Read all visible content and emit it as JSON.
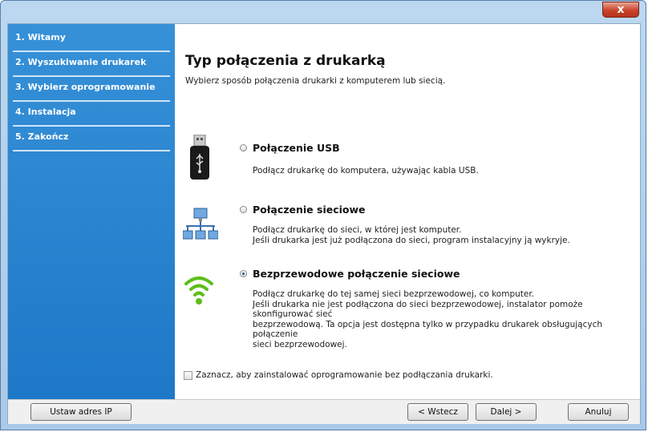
{
  "window": {
    "close_symbol": "x"
  },
  "sidebar": {
    "items": [
      {
        "label": "1. Witamy"
      },
      {
        "label": "2. Wyszukiwanie drukarek"
      },
      {
        "label": "3. Wybierz oprogramowanie"
      },
      {
        "label": "4. Instalacja"
      },
      {
        "label": "5. Zakończ"
      }
    ]
  },
  "main": {
    "title": "Typ połączenia z drukarką",
    "subtitle": "Wybierz sposób połączenia drukarki z komputerem lub siecią.",
    "options": [
      {
        "title": "Połączenie USB",
        "icon": "usb-drive-icon",
        "selected": false,
        "description": [
          "Podłącz drukarkę do komputera, używając kabla USB."
        ]
      },
      {
        "title": "Połączenie sieciowe",
        "icon": "network-icon",
        "selected": false,
        "description": [
          "Podłącz drukarkę do sieci, w której jest komputer.",
          "Jeśli drukarka jest już podłączona do sieci, program instalacyjny ją wykryje."
        ]
      },
      {
        "title": "Bezprzewodowe połączenie sieciowe",
        "icon": "wifi-icon",
        "selected": true,
        "description": [
          "Podłącz drukarkę do tej samej sieci bezprzewodowej, co komputer.",
          "Jeśli drukarka nie jest podłączona do sieci bezprzewodowej, instalator pomoże skonfigurować sieć",
          "bezprzewodową. Ta opcja jest dostępna tylko w przypadku drukarek obsługujących połączenie",
          "sieci bezprzewodowej."
        ]
      }
    ],
    "checkbox_label": "Zaznacz, aby zainstalować oprogramowanie bez podłączania drukarki."
  },
  "footer": {
    "set_ip_label": "Ustaw adres IP",
    "back_label": "< Wstecz",
    "next_label": "Dalej >",
    "cancel_label": "Anuluj"
  },
  "colors": {
    "sidebar": "#1e78c8",
    "close_button": "#c8442a",
    "wifi_green": "#5cbf1a"
  }
}
